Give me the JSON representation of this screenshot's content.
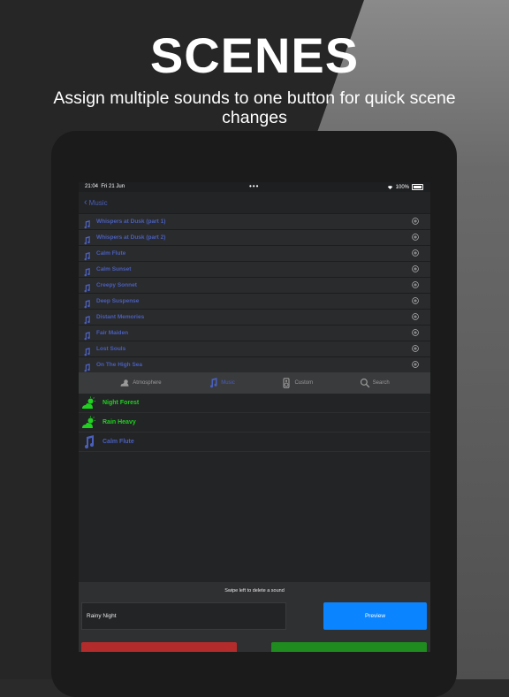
{
  "promo": {
    "headline": "SCENES",
    "subline": "Assign multiple sounds to one button for quick scene changes"
  },
  "status_bar": {
    "time": "21:04",
    "date": "Fri 21 Jun",
    "dots": "•••",
    "battery": "100%"
  },
  "nav": {
    "back_label": "Music"
  },
  "music_list": [
    {
      "label": "Whispers at Dusk (part 1)"
    },
    {
      "label": "Whispers at Dusk (part 2)"
    },
    {
      "label": "Calm Flute"
    },
    {
      "label": "Calm Sunset"
    },
    {
      "label": "Creepy Sonnet"
    },
    {
      "label": "Deep Suspense"
    },
    {
      "label": "Distant Memories"
    },
    {
      "label": "Fair Maiden"
    },
    {
      "label": "Lost Souls"
    },
    {
      "label": "On The High Sea"
    }
  ],
  "tabs": [
    {
      "label": "Atmosphere",
      "icon": "weather-icon",
      "active": false
    },
    {
      "label": "Music",
      "icon": "music-note-icon",
      "active": true
    },
    {
      "label": "Custom",
      "icon": "speaker-icon",
      "active": false
    },
    {
      "label": "Search",
      "icon": "search-icon",
      "active": false
    }
  ],
  "scene_sounds": [
    {
      "label": "Night Forest",
      "icon": "weather-icon",
      "color": "#1fd21f"
    },
    {
      "label": "Rain Heavy",
      "icon": "weather-icon",
      "color": "#1fd21f"
    },
    {
      "label": "Calm Flute",
      "icon": "music-note-icon",
      "color": "#4a5fbd"
    }
  ],
  "footer": {
    "hint": "Swipe left to delete a sound",
    "scene_name_value": "Rainy Night",
    "preview_label": "Preview"
  },
  "colors": {
    "accent_blue": "#4a5fbd",
    "preview_blue": "#0a84ff",
    "atmosphere_green": "#1fd21f",
    "danger_red": "#b32b2b",
    "confirm_green": "#1e8c1e"
  }
}
